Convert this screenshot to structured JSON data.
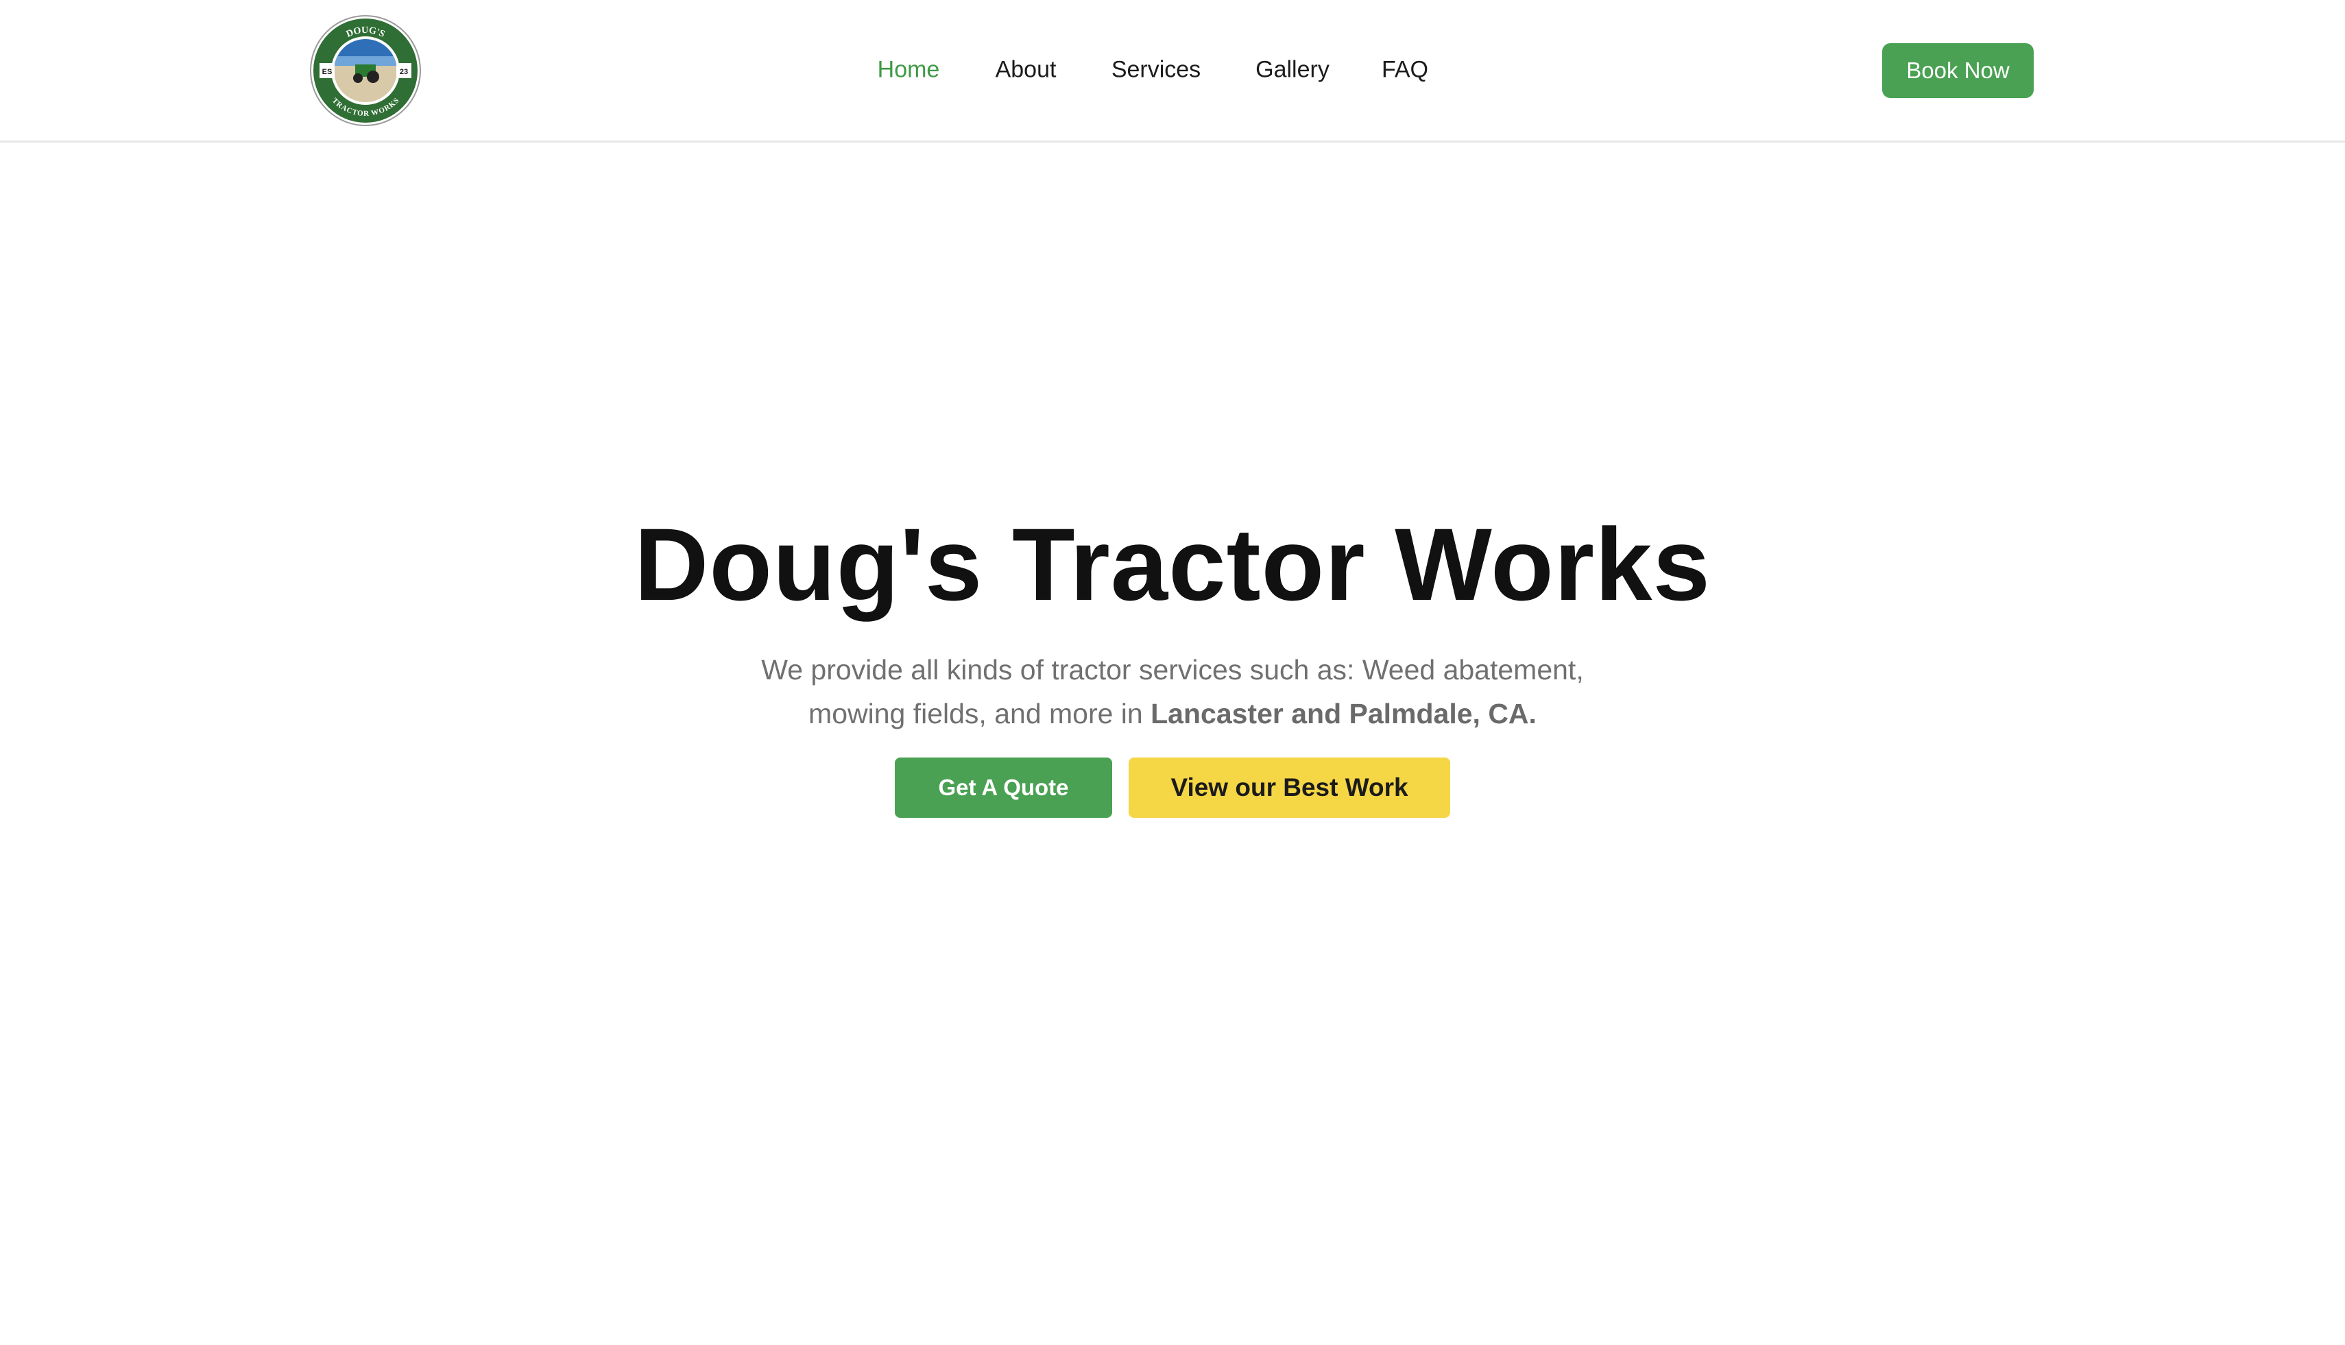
{
  "header": {
    "logo": {
      "top_text": "DOUG'S",
      "bottom_text": "TRACTOR WORKS",
      "left_text": "ES",
      "right_text": "23"
    },
    "nav": [
      {
        "label": "Home",
        "active": true
      },
      {
        "label": "About",
        "active": false
      },
      {
        "label": "Services",
        "active": false
      },
      {
        "label": "Gallery",
        "active": false
      },
      {
        "label": "FAQ",
        "active": false
      }
    ],
    "cta_label": "Book Now"
  },
  "hero": {
    "title": "Doug's Tractor Works",
    "subtitle_line1": "We provide all kinds of tractor services such as: Weed abatement,",
    "subtitle_line2_prefix": "mowing fields, and more in ",
    "subtitle_line2_bold": "Lancaster and Palmdale, CA.",
    "primary_button": "Get A Quote",
    "secondary_button": "View our Best Work"
  },
  "colors": {
    "brand_green": "#4aa153",
    "active_nav": "#3f9a45",
    "accent_yellow": "#f5d645",
    "title": "#111111",
    "subtitle": "#707070"
  }
}
